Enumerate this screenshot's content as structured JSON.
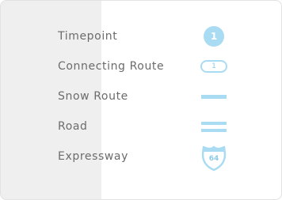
{
  "legend": {
    "items": [
      {
        "label": "Timepoint",
        "icon": "timepoint-circle-icon",
        "badge_text": "1"
      },
      {
        "label": "Connecting Route",
        "icon": "connecting-route-pill-icon",
        "badge_text": "1"
      },
      {
        "label": "Snow Route",
        "icon": "snow-route-line-icon"
      },
      {
        "label": "Road",
        "icon": "road-double-line-icon"
      },
      {
        "label": "Expressway",
        "icon": "expressway-shield-icon",
        "badge_text": "64"
      }
    ],
    "colors": {
      "icon_fill": "#a9dcf3",
      "label_text": "#6b6b6b",
      "left_band": "#efefef",
      "background": "#ffffff"
    }
  }
}
